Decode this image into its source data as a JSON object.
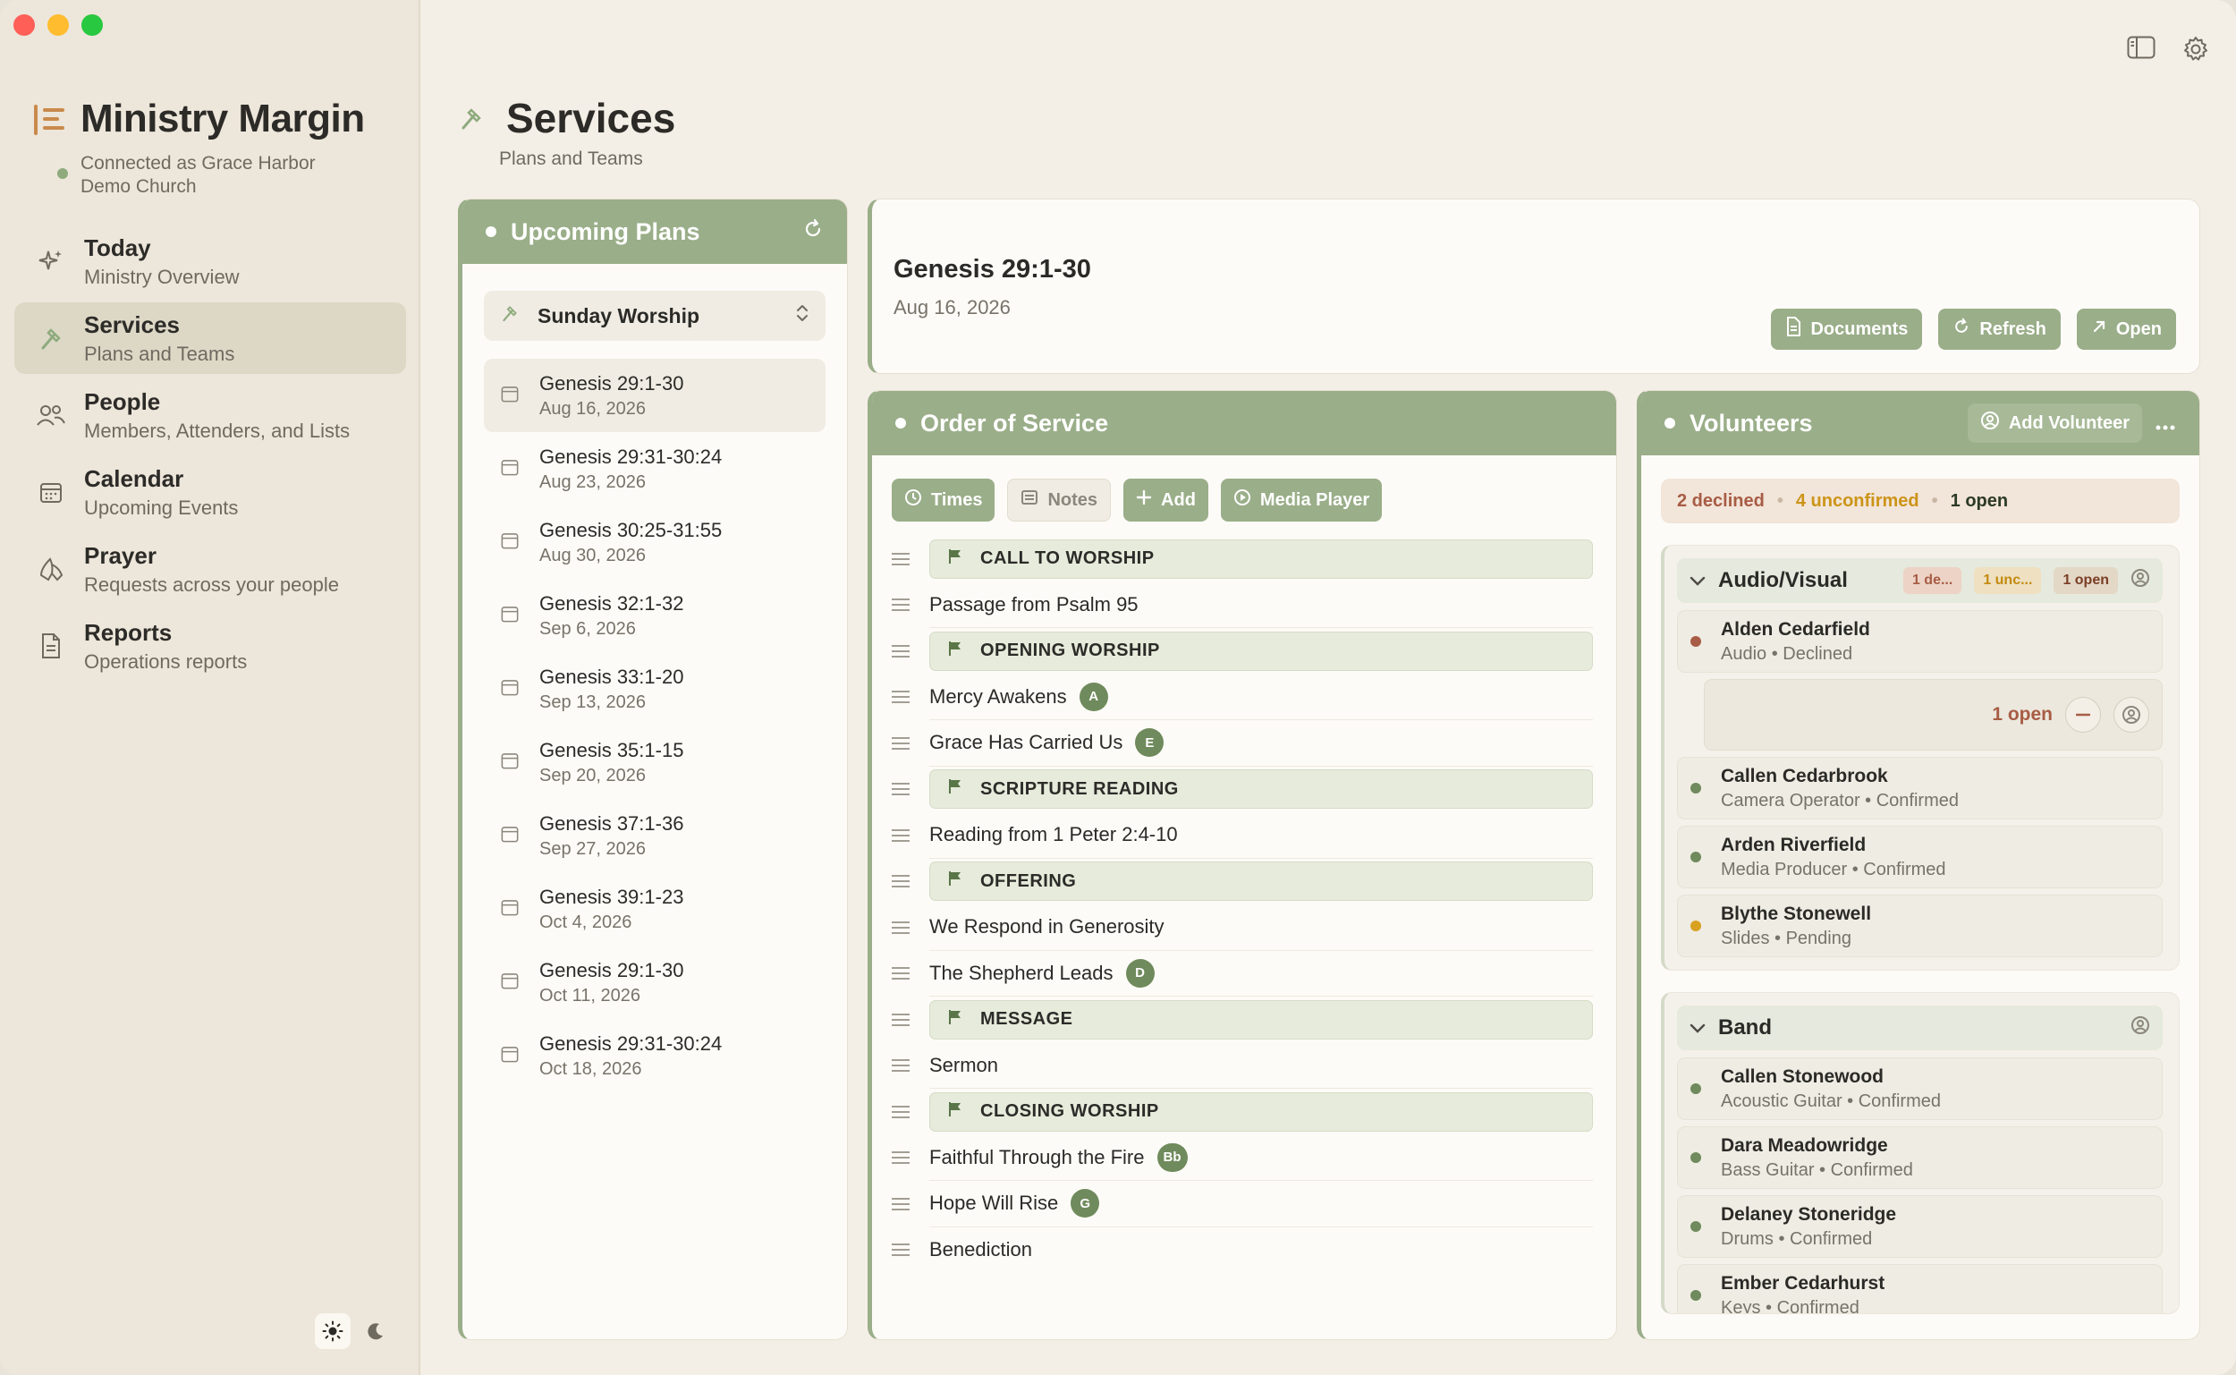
{
  "app": {
    "title": "Ministry Margin",
    "connection": "Connected as Grace Harbor Demo Church"
  },
  "sidebar": {
    "items": [
      {
        "title": "Today",
        "subtitle": "Ministry Overview"
      },
      {
        "title": "Services",
        "subtitle": "Plans and Teams"
      },
      {
        "title": "People",
        "subtitle": "Members, Attenders, and Lists"
      },
      {
        "title": "Calendar",
        "subtitle": "Upcoming Events"
      },
      {
        "title": "Prayer",
        "subtitle": "Requests across your people"
      },
      {
        "title": "Reports",
        "subtitle": "Operations reports"
      }
    ]
  },
  "header": {
    "title": "Services",
    "subtitle": "Plans and Teams"
  },
  "plans": {
    "title": "Upcoming Plans",
    "service_type": "Sunday Worship",
    "items": [
      {
        "name": "Genesis 29:1-30",
        "date": "Aug 16, 2026"
      },
      {
        "name": "Genesis 29:31-30:24",
        "date": "Aug 23, 2026"
      },
      {
        "name": "Genesis 30:25-31:55",
        "date": "Aug 30, 2026"
      },
      {
        "name": "Genesis 32:1-32",
        "date": "Sep 6, 2026"
      },
      {
        "name": "Genesis 33:1-20",
        "date": "Sep 13, 2026"
      },
      {
        "name": "Genesis 35:1-15",
        "date": "Sep 20, 2026"
      },
      {
        "name": "Genesis 37:1-36",
        "date": "Sep 27, 2026"
      },
      {
        "name": "Genesis 39:1-23",
        "date": "Oct 4, 2026"
      },
      {
        "name": "Genesis 29:1-30",
        "date": "Oct 11, 2026"
      },
      {
        "name": "Genesis 29:31-30:24",
        "date": "Oct 18, 2026"
      }
    ]
  },
  "detail": {
    "title": "Genesis 29:1-30",
    "date": "Aug 16, 2026",
    "buttons": {
      "documents": "Documents",
      "refresh": "Refresh",
      "open": "Open"
    }
  },
  "order": {
    "title": "Order of Service",
    "tools": {
      "times": "Times",
      "notes": "Notes",
      "add": "Add",
      "media": "Media Player"
    },
    "rows": [
      {
        "type": "header",
        "text": "CALL TO WORSHIP"
      },
      {
        "type": "item",
        "text": "Passage from Psalm 95"
      },
      {
        "type": "header",
        "text": "OPENING WORSHIP"
      },
      {
        "type": "item",
        "text": "Mercy Awakens",
        "badge": "A"
      },
      {
        "type": "item",
        "text": "Grace Has Carried Us",
        "badge": "E"
      },
      {
        "type": "header",
        "text": "SCRIPTURE READING"
      },
      {
        "type": "item",
        "text": "Reading from 1 Peter 2:4-10"
      },
      {
        "type": "header",
        "text": "OFFERING"
      },
      {
        "type": "item",
        "text": "We Respond in Generosity"
      },
      {
        "type": "item",
        "text": "The Shepherd Leads",
        "badge": "D"
      },
      {
        "type": "header",
        "text": "MESSAGE"
      },
      {
        "type": "item",
        "text": "Sermon"
      },
      {
        "type": "header",
        "text": "CLOSING WORSHIP"
      },
      {
        "type": "item",
        "text": "Faithful Through the Fire",
        "badge": "Bb"
      },
      {
        "type": "item",
        "text": "Hope Will Rise",
        "badge": "G"
      },
      {
        "type": "item",
        "text": "Benediction"
      }
    ]
  },
  "volunteers": {
    "title": "Volunteers",
    "add_label": "Add Volunteer",
    "summary": {
      "declined": "2 declined",
      "unconfirmed": "4 unconfirmed",
      "open": "1 open"
    },
    "av": {
      "name": "Audio/Visual",
      "pills": {
        "declined": "1 de...",
        "unconfirmed": "1 unc...",
        "open": "1 open"
      },
      "people": [
        {
          "name": "Alden Cedarfield",
          "role": "Audio • Declined"
        },
        {
          "name": "Callen Cedarbrook",
          "role": "Camera Operator • Confirmed"
        },
        {
          "name": "Arden Riverfield",
          "role": "Media Producer • Confirmed"
        },
        {
          "name": "Blythe Stonewell",
          "role": "Slides • Pending"
        }
      ],
      "open_slot": "1 open"
    },
    "band": {
      "name": "Band",
      "people": [
        {
          "name": "Callen Stonewood",
          "role": "Acoustic Guitar • Confirmed"
        },
        {
          "name": "Dara Meadowridge",
          "role": "Bass Guitar • Confirmed"
        },
        {
          "name": "Delaney Stoneridge",
          "role": "Drums • Confirmed"
        },
        {
          "name": "Ember Cedarhurst",
          "role": "Keys • Confirmed"
        }
      ]
    }
  },
  "colors": {
    "accent": "#9aae89",
    "declined": "#a85c45",
    "pending": "#d8a120",
    "confirmed": "#6f8a5c"
  }
}
